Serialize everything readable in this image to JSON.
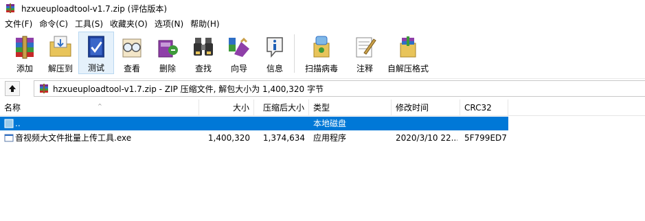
{
  "window": {
    "title": "hzxueuploadtool-v1.7.zip (评估版本)"
  },
  "menu": [
    "文件(F)",
    "命令(C)",
    "工具(S)",
    "收藏夹(O)",
    "选项(N)",
    "帮助(H)"
  ],
  "toolbar": {
    "add": "添加",
    "extract": "解压到",
    "test": "测试",
    "view": "查看",
    "delete": "删除",
    "find": "查找",
    "wizard": "向导",
    "info": "信息",
    "virus_scan": "扫描病毒",
    "comment": "注释",
    "sfx": "自解压格式"
  },
  "address": {
    "path": "hzxueuploadtool-v1.7.zip - ZIP 压缩文件, 解包大小为 1,400,320 字节"
  },
  "columns": {
    "name": "名称",
    "size": "大小",
    "packed": "压缩后大小",
    "type": "类型",
    "modified": "修改时间",
    "crc": "CRC32"
  },
  "rows": [
    {
      "name": "..",
      "size": "",
      "packed": "",
      "type": "本地磁盘",
      "modified": "",
      "crc": ""
    },
    {
      "name": "音视频大文件批量上传工具.exe",
      "size": "1,400,320",
      "packed": "1,374,634",
      "type": "应用程序",
      "modified": "2020/3/10 22...",
      "crc": "5F799ED7"
    }
  ],
  "colors": {
    "selection": "#0078d7",
    "active_tool": "#e5f1fb"
  }
}
